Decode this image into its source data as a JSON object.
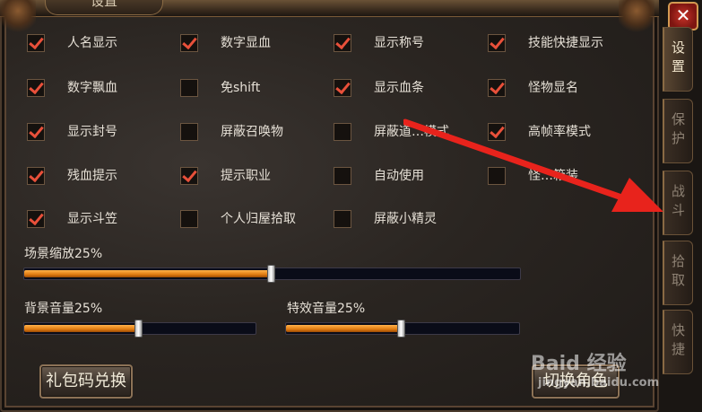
{
  "window": {
    "title": "设置",
    "close_label": "✕"
  },
  "options": [
    {
      "label": "人名显示",
      "checked": true
    },
    {
      "label": "数字显血",
      "checked": true
    },
    {
      "label": "显示称号",
      "checked": true
    },
    {
      "label": "技能快捷显示",
      "checked": true
    },
    {
      "label": "数字飘血",
      "checked": true
    },
    {
      "label": "免shift",
      "checked": false
    },
    {
      "label": "显示血条",
      "checked": true
    },
    {
      "label": "怪物显名",
      "checked": true
    },
    {
      "label": "显示封号",
      "checked": true
    },
    {
      "label": "屏蔽召唤物",
      "checked": false
    },
    {
      "label": "屏蔽道…模式",
      "checked": false
    },
    {
      "label": "高帧率模式",
      "checked": true
    },
    {
      "label": "残血提示",
      "checked": true
    },
    {
      "label": "提示职业",
      "checked": true
    },
    {
      "label": "自动使用",
      "checked": false
    },
    {
      "label": "怪…箱装",
      "checked": false
    },
    {
      "label": "显示斗笠",
      "checked": true
    },
    {
      "label": "个人归屋拾取",
      "checked": false
    },
    {
      "label": "屏蔽小精灵",
      "checked": false
    }
  ],
  "sliders": {
    "scene_zoom": {
      "label": "场景缩放25%",
      "value": 0.25
    },
    "bg_volume": {
      "label": "背景音量25%",
      "value": 0.25
    },
    "fx_volume": {
      "label": "特效音量25%",
      "value": 0.25
    }
  },
  "buttons": {
    "gift_code": "礼包码兑换",
    "switch_role": "切换角色"
  },
  "side_tabs": [
    {
      "label": "设置",
      "active": true
    },
    {
      "label": "保护",
      "active": false
    },
    {
      "label": "战斗",
      "active": false
    },
    {
      "label": "拾取",
      "active": false
    },
    {
      "label": "快捷",
      "active": false
    }
  ],
  "watermark": {
    "main": "Baid 经验",
    "sub": "jingyan.baidu.com"
  },
  "colors": {
    "check": "#e8503a",
    "slider_fill": "#e07a10",
    "annotation_arrow": "#e8231c"
  }
}
